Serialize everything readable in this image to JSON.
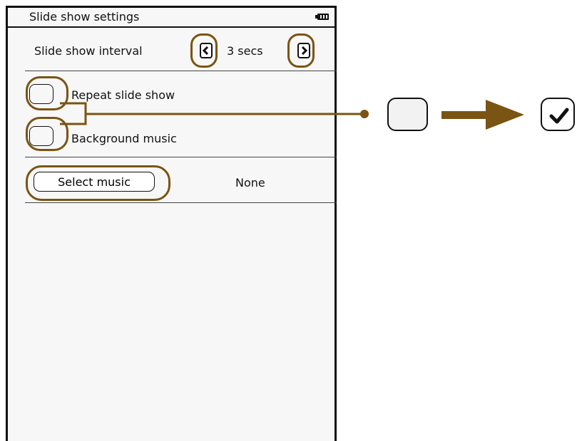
{
  "screen": {
    "title": "Slide show settings",
    "battery_icon": "battery-full-icon"
  },
  "interval": {
    "label": "Slide show interval",
    "value": "3 secs",
    "prev_icon": "chevron-left-icon",
    "next_icon": "chevron-right-icon"
  },
  "repeat": {
    "label": "Repeat slide show",
    "checked": false
  },
  "music": {
    "label": "Background music",
    "checked": false
  },
  "select_music": {
    "button_label": "Select music",
    "value": "None"
  },
  "annotation": {
    "highlight_color": "#7a5412",
    "unchecked_icon": "checkbox-unchecked-icon",
    "arrow_icon": "arrow-right-icon",
    "checked_icon": "checkbox-checked-icon"
  }
}
